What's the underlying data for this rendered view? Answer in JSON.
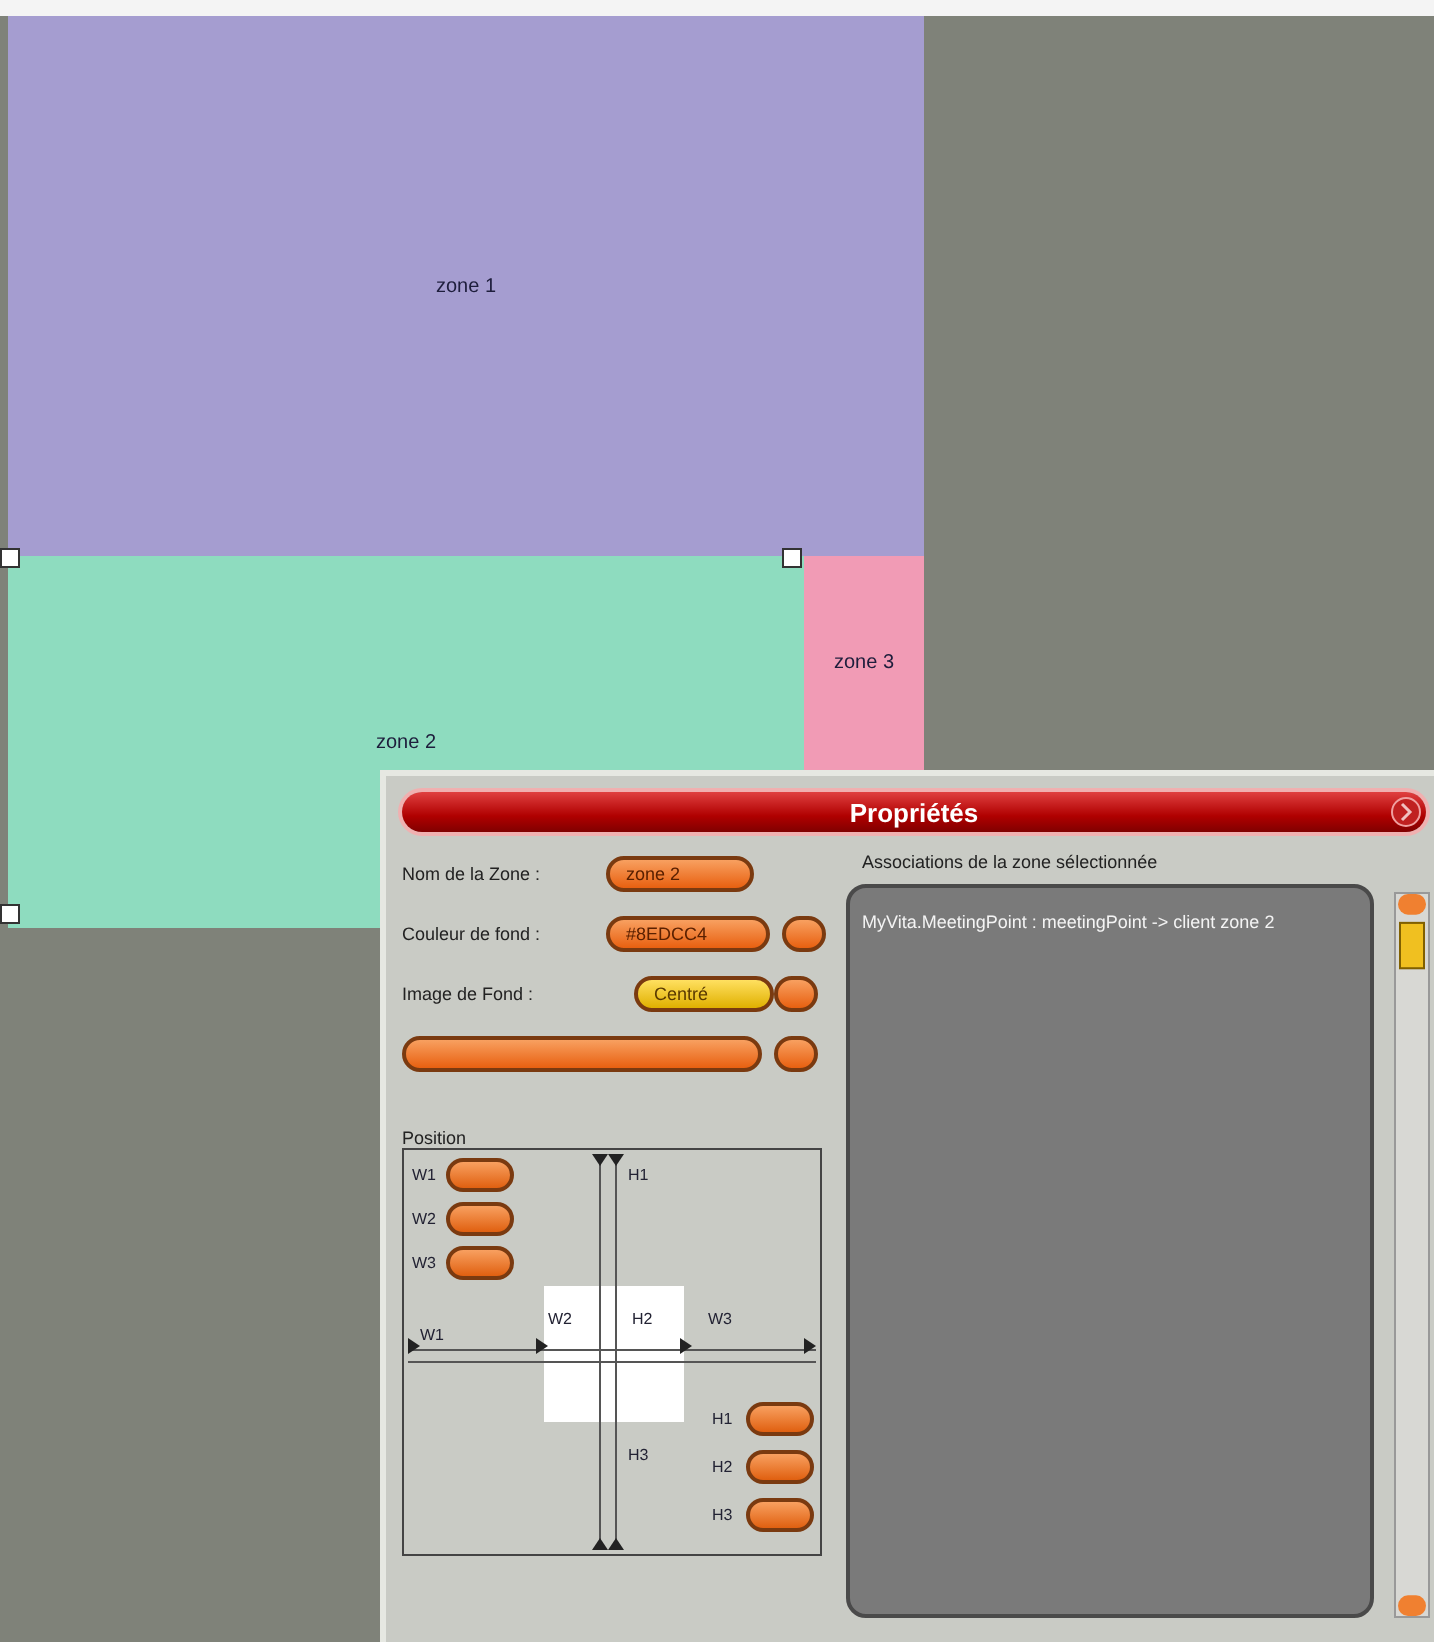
{
  "zones": [
    {
      "label": "zone 1",
      "color": "#a59dd0"
    },
    {
      "label": "zone 2",
      "color": "#8edcbf"
    },
    {
      "label": "zone 3",
      "color": "#f19bb5"
    }
  ],
  "panel": {
    "title": "Propriétés",
    "fields": [
      {
        "kind": "text",
        "label": "Nom de la Zone :",
        "value": "zone 2"
      },
      {
        "kind": "color",
        "label": "Couleur de fond :",
        "value": "#8EDCC4"
      },
      {
        "kind": "select",
        "label": "Image de Fond :",
        "value": "Centré"
      }
    ],
    "position": {
      "label": "Position",
      "width_fields": [
        "W1",
        "W2",
        "W3"
      ],
      "height_fields": [
        "H1",
        "H2",
        "H3"
      ],
      "diagram_labels": [
        "H1",
        "W1",
        "W2",
        "H2",
        "W3",
        "H3"
      ]
    },
    "associations": {
      "label": "Associations de la zone sélectionnée",
      "items": [
        "MyVita.MeetingPoint : meetingPoint -> client zone 2"
      ]
    }
  }
}
